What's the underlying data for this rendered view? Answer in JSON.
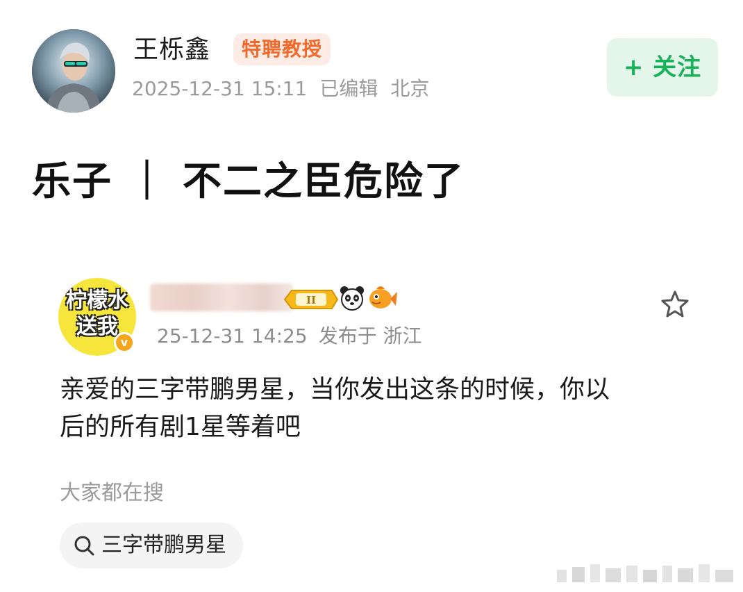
{
  "author": {
    "name": "王栎鑫",
    "badge": "特聘教授",
    "date": "2025-12-31 15:11",
    "edited": "已编辑",
    "location": "北京",
    "avatar_icon": "user-avatar"
  },
  "follow": {
    "label": "+ 关注",
    "color": "#15b25a"
  },
  "post": {
    "title": "乐子 ｜ 不二之臣危险了"
  },
  "embed": {
    "avatar_text": [
      "柠檬水",
      "送我"
    ],
    "level": "II",
    "time": "25-12-31 14:25",
    "published_at": "发布于 浙江",
    "body_lines": [
      "亲爱的三字带鹏男星，当你发出这条的时候，你以",
      "后的所有剧1星等着吧"
    ],
    "hot_search_label": "大家都在搜",
    "search_chip": "三字带鹏男星",
    "icons": [
      "panda-icon",
      "fish-icon",
      "star-icon",
      "search-icon",
      "verified-icon"
    ]
  }
}
